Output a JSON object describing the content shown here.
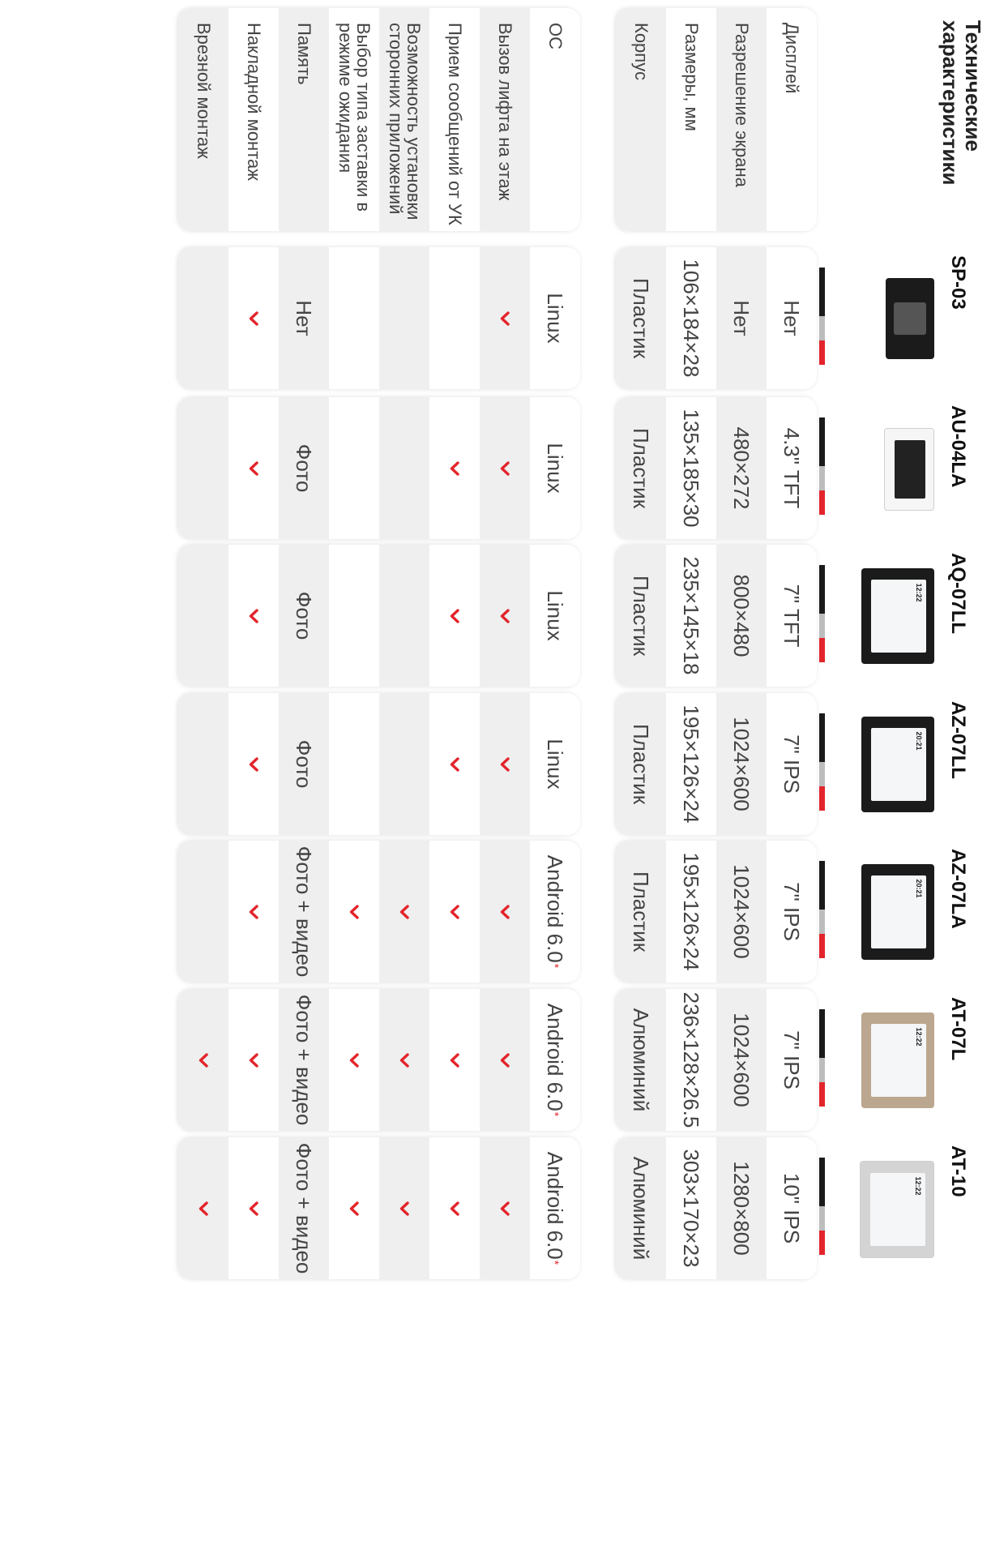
{
  "title": "Технические характеристики",
  "colors": {
    "accent": "#e3242b",
    "row_alt": "#efefef"
  },
  "groupA": [
    {
      "key": "display",
      "label": "Дисплей"
    },
    {
      "key": "resolution",
      "label": "Разрешение экрана"
    },
    {
      "key": "size",
      "label": "Размеры, мм"
    },
    {
      "key": "body",
      "label": "Корпус"
    }
  ],
  "groupB": [
    {
      "key": "os",
      "label": "ОС"
    },
    {
      "key": "lift",
      "label": "Вызов лифта на этаж"
    },
    {
      "key": "messages",
      "label": "Прием сообщений от УК"
    },
    {
      "key": "apps",
      "label": "Возможность установки сторонних приложений"
    },
    {
      "key": "screensaver",
      "label": "Выбор типа заставки в режиме ожидания"
    },
    {
      "key": "memory",
      "label": "Память"
    },
    {
      "key": "surface",
      "label": "Накладной монтаж"
    },
    {
      "key": "flush",
      "label": "Врезной монтаж"
    }
  ],
  "models": [
    {
      "name": "SP-03",
      "device_icon": "sp03-device-image",
      "display": "Нет",
      "resolution": "Нет",
      "size": "106×184×28",
      "body": "Пластик",
      "os": "Linux",
      "lift": true,
      "messages": false,
      "apps": false,
      "screensaver": false,
      "memory": "Нет",
      "surface": true,
      "flush": false
    },
    {
      "name": "AU-04LA",
      "device_icon": "au04la-device-image",
      "display": "4.3\" TFT",
      "resolution": "480×272",
      "size": "135×185×30",
      "body": "Пластик",
      "os": "Linux",
      "lift": true,
      "messages": true,
      "apps": false,
      "screensaver": false,
      "memory": "Фото",
      "surface": true,
      "flush": false
    },
    {
      "name": "AQ-07LL",
      "device_icon": "aq07ll-device-image",
      "display": "7\" TFT",
      "resolution": "800×480",
      "size": "235×145×18",
      "body": "Пластик",
      "os": "Linux",
      "lift": true,
      "messages": true,
      "apps": false,
      "screensaver": false,
      "memory": "Фото",
      "surface": true,
      "flush": false
    },
    {
      "name": "AZ-07LL",
      "device_icon": "az07ll-device-image",
      "display": "7\" IPS",
      "resolution": "1024×600",
      "size": "195×126×24",
      "body": "Пластик",
      "os": "Linux",
      "lift": true,
      "messages": true,
      "apps": false,
      "screensaver": false,
      "memory": "Фото",
      "surface": true,
      "flush": false
    },
    {
      "name": "AZ-07LA",
      "device_icon": "az07la-device-image",
      "display": "7\" IPS",
      "resolution": "1024×600",
      "size": "195×126×24",
      "body": "Пластик",
      "os": "Android 6.0",
      "os_note": "*",
      "lift": true,
      "messages": true,
      "apps": true,
      "screensaver": true,
      "memory": "Фото + видео",
      "surface": true,
      "flush": false
    },
    {
      "name": "AT-07L",
      "device_icon": "at07l-device-image",
      "display": "7\" IPS",
      "resolution": "1024×600",
      "size": "236×128×26.5",
      "body": "Алюминий",
      "os": "Android 6.0",
      "os_note": "*",
      "lift": true,
      "messages": true,
      "apps": true,
      "screensaver": true,
      "memory": "Фото + видео",
      "surface": true,
      "flush": true
    },
    {
      "name": "AT-10",
      "device_icon": "at10-device-image",
      "display": "10\" IPS",
      "resolution": "1280×800",
      "size": "303×170×23",
      "body": "Алюминий",
      "os": "Android 6.0",
      "os_note": "*",
      "lift": true,
      "messages": true,
      "apps": true,
      "screensaver": true,
      "memory": "Фото + видео",
      "surface": true,
      "flush": true
    }
  ],
  "screen_times": {
    "AQ-07LL": "12:22",
    "AZ-07LL": "20:21",
    "AZ-07LA": "20:21",
    "AT-07L": "12:22",
    "AT-10": "12:22"
  }
}
